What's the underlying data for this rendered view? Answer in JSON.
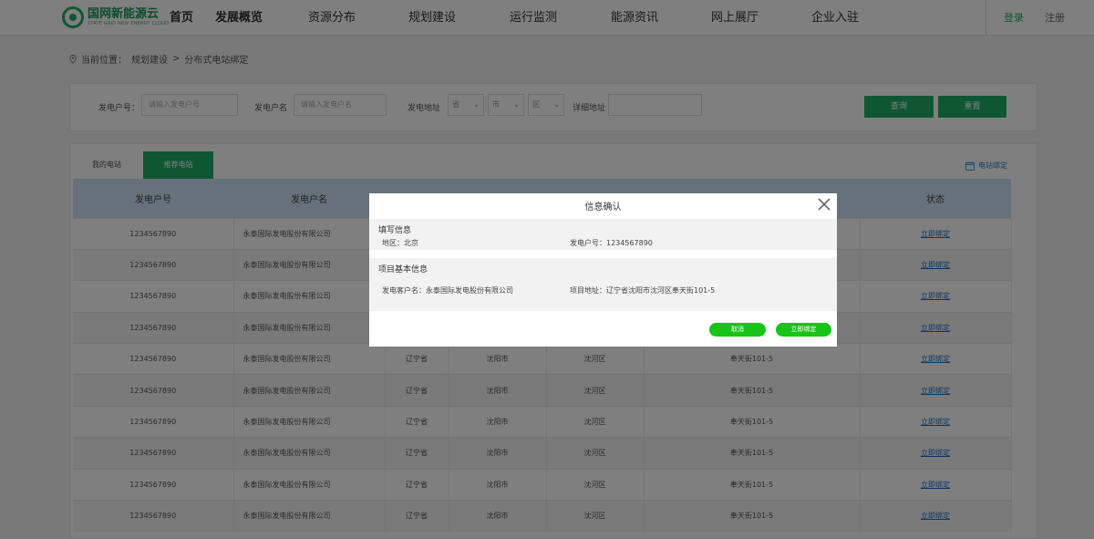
{
  "brand": {
    "name_cn": "国网新能源云",
    "name_en": "STATE GRID NEW ENERGY CLOUD"
  },
  "nav": [
    {
      "label": "首页"
    },
    {
      "label": "发展概览"
    },
    {
      "label": "资源分布"
    },
    {
      "label": "规划建设"
    },
    {
      "label": "运行监测"
    },
    {
      "label": "能源资讯"
    },
    {
      "label": "网上展厅"
    },
    {
      "label": "企业入驻"
    }
  ],
  "auth": {
    "login": "登录",
    "register": "注册"
  },
  "breadcrumb": {
    "prefix": "当前位置：",
    "level1": "规划建设",
    "sep": ">",
    "level2": "分布式电站绑定"
  },
  "search": {
    "account_label": "发电户号：",
    "account_placeholder": "请输入发电户号",
    "name_label": "发电户名",
    "name_placeholder": "请输入发电户名",
    "address_label": "发电地址",
    "province": "省",
    "city": "市",
    "district": "区",
    "detail_label": "详细地址",
    "query_button": "查询",
    "reset_button": "重置"
  },
  "tabs": {
    "tab1": "我的电站",
    "tab2": "推荐电站"
  },
  "bind_link": "电站绑定",
  "table": {
    "headers": [
      "发电户号",
      "发电户名",
      "",
      "",
      "",
      "",
      "状态"
    ],
    "rows": [
      {
        "id": "1234567890",
        "name": "永泰国际发电股份有限公司",
        "province": "",
        "city": "",
        "district": "",
        "address": "",
        "status": "立即绑定"
      },
      {
        "id": "1234567890",
        "name": "永泰国际发电股份有限公司",
        "province": "",
        "city": "",
        "district": "",
        "address": "",
        "status": "立即绑定"
      },
      {
        "id": "1234567890",
        "name": "永泰国际发电股份有限公司",
        "province": "",
        "city": "",
        "district": "",
        "address": "",
        "status": "立即绑定"
      },
      {
        "id": "1234567890",
        "name": "永泰国际发电股份有限公司",
        "province": "",
        "city": "",
        "district": "",
        "address": "",
        "status": "立即绑定"
      },
      {
        "id": "1234567890",
        "name": "永泰国际发电股份有限公司",
        "province": "辽宁省",
        "city": "沈阳市",
        "district": "沈河区",
        "address": "奉天街101-5",
        "status": "立即绑定"
      },
      {
        "id": "1234567890",
        "name": "永泰国际发电股份有限公司",
        "province": "辽宁省",
        "city": "沈阳市",
        "district": "沈河区",
        "address": "奉天街101-5",
        "status": "立即绑定"
      },
      {
        "id": "1234567890",
        "name": "永泰国际发电股份有限公司",
        "province": "辽宁省",
        "city": "沈阳市",
        "district": "沈河区",
        "address": "奉天街101-5",
        "status": "立即绑定"
      },
      {
        "id": "1234567890",
        "name": "永泰国际发电股份有限公司",
        "province": "辽宁省",
        "city": "沈阳市",
        "district": "沈河区",
        "address": "奉天街101-5",
        "status": "立即绑定"
      },
      {
        "id": "1234567890",
        "name": "永泰国际发电股份有限公司",
        "province": "辽宁省",
        "city": "沈阳市",
        "district": "沈河区",
        "address": "奉天街101-5",
        "status": "立即绑定"
      },
      {
        "id": "1234567890",
        "name": "永泰国际发电股份有限公司",
        "province": "辽宁省",
        "city": "沈阳市",
        "district": "沈河区",
        "address": "奉天街101-5",
        "status": "立即绑定"
      }
    ]
  },
  "modal": {
    "title": "信息确认",
    "section1_title": "填写信息",
    "region": "地区：北京",
    "account": "发电户号：1234567890",
    "section2_title": "项目基本信息",
    "customer_name": "发电客户名：永泰国际发电股份有限公司",
    "project_address": "项目地址：辽宁省沈阳市沈河区奉天街101-5",
    "cancel_button": "取消",
    "confirm_button": "立即绑定"
  },
  "colors": {
    "brand_green": "#1fae66",
    "button_green": "#17c417",
    "link_blue": "#1a6cc4",
    "table_header": "#cfe3f6"
  },
  "icons": {
    "logo": "logo-icon",
    "location": "location-pin-icon",
    "calendar": "calendar-icon",
    "close": "close-icon"
  }
}
